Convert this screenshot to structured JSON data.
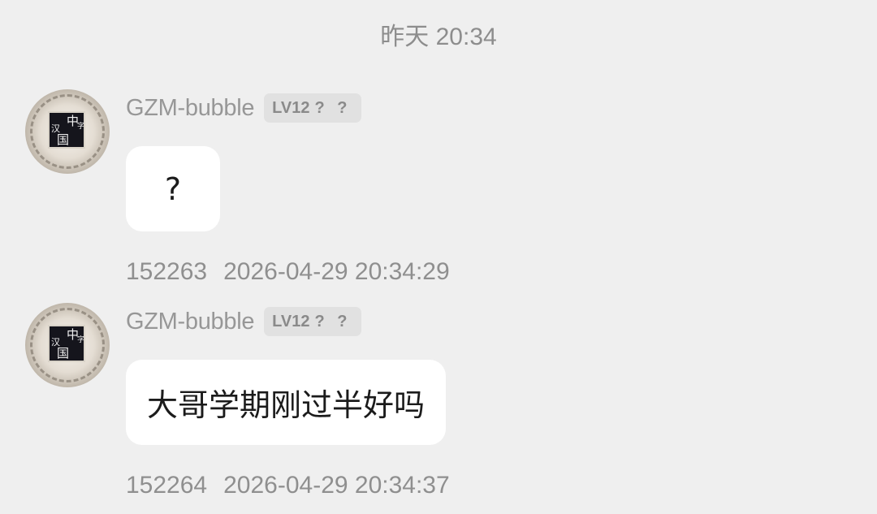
{
  "conversation": {
    "day_stamp": "昨天 20:34"
  },
  "messages": [
    {
      "username": "GZM-bubble",
      "level": "LV12",
      "level_marks": "? ?",
      "text": "?",
      "message_id": "152263",
      "timestamp": "2026-04-29 20:34:29"
    },
    {
      "username": "GZM-bubble",
      "level": "LV12",
      "level_marks": "? ?",
      "text": "大哥学期刚过半好吗",
      "message_id": "152264",
      "timestamp": "2026-04-29 20:34:37"
    }
  ],
  "avatar": {
    "glyphs": [
      "中",
      "字",
      "汉",
      "国"
    ]
  }
}
